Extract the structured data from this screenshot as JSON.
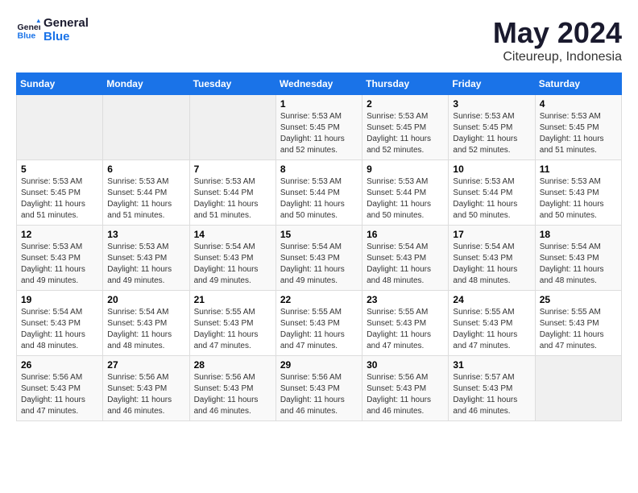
{
  "logo": {
    "line1": "General",
    "line2": "Blue"
  },
  "title": "May 2024",
  "subtitle": "Citeureup, Indonesia",
  "days_of_week": [
    "Sunday",
    "Monday",
    "Tuesday",
    "Wednesday",
    "Thursday",
    "Friday",
    "Saturday"
  ],
  "weeks": [
    [
      {
        "day": "",
        "info": ""
      },
      {
        "day": "",
        "info": ""
      },
      {
        "day": "",
        "info": ""
      },
      {
        "day": "1",
        "info": "Sunrise: 5:53 AM\nSunset: 5:45 PM\nDaylight: 11 hours and 52 minutes."
      },
      {
        "day": "2",
        "info": "Sunrise: 5:53 AM\nSunset: 5:45 PM\nDaylight: 11 hours and 52 minutes."
      },
      {
        "day": "3",
        "info": "Sunrise: 5:53 AM\nSunset: 5:45 PM\nDaylight: 11 hours and 52 minutes."
      },
      {
        "day": "4",
        "info": "Sunrise: 5:53 AM\nSunset: 5:45 PM\nDaylight: 11 hours and 51 minutes."
      }
    ],
    [
      {
        "day": "5",
        "info": "Sunrise: 5:53 AM\nSunset: 5:45 PM\nDaylight: 11 hours and 51 minutes."
      },
      {
        "day": "6",
        "info": "Sunrise: 5:53 AM\nSunset: 5:44 PM\nDaylight: 11 hours and 51 minutes."
      },
      {
        "day": "7",
        "info": "Sunrise: 5:53 AM\nSunset: 5:44 PM\nDaylight: 11 hours and 51 minutes."
      },
      {
        "day": "8",
        "info": "Sunrise: 5:53 AM\nSunset: 5:44 PM\nDaylight: 11 hours and 50 minutes."
      },
      {
        "day": "9",
        "info": "Sunrise: 5:53 AM\nSunset: 5:44 PM\nDaylight: 11 hours and 50 minutes."
      },
      {
        "day": "10",
        "info": "Sunrise: 5:53 AM\nSunset: 5:44 PM\nDaylight: 11 hours and 50 minutes."
      },
      {
        "day": "11",
        "info": "Sunrise: 5:53 AM\nSunset: 5:43 PM\nDaylight: 11 hours and 50 minutes."
      }
    ],
    [
      {
        "day": "12",
        "info": "Sunrise: 5:53 AM\nSunset: 5:43 PM\nDaylight: 11 hours and 49 minutes."
      },
      {
        "day": "13",
        "info": "Sunrise: 5:53 AM\nSunset: 5:43 PM\nDaylight: 11 hours and 49 minutes."
      },
      {
        "day": "14",
        "info": "Sunrise: 5:54 AM\nSunset: 5:43 PM\nDaylight: 11 hours and 49 minutes."
      },
      {
        "day": "15",
        "info": "Sunrise: 5:54 AM\nSunset: 5:43 PM\nDaylight: 11 hours and 49 minutes."
      },
      {
        "day": "16",
        "info": "Sunrise: 5:54 AM\nSunset: 5:43 PM\nDaylight: 11 hours and 48 minutes."
      },
      {
        "day": "17",
        "info": "Sunrise: 5:54 AM\nSunset: 5:43 PM\nDaylight: 11 hours and 48 minutes."
      },
      {
        "day": "18",
        "info": "Sunrise: 5:54 AM\nSunset: 5:43 PM\nDaylight: 11 hours and 48 minutes."
      }
    ],
    [
      {
        "day": "19",
        "info": "Sunrise: 5:54 AM\nSunset: 5:43 PM\nDaylight: 11 hours and 48 minutes."
      },
      {
        "day": "20",
        "info": "Sunrise: 5:54 AM\nSunset: 5:43 PM\nDaylight: 11 hours and 48 minutes."
      },
      {
        "day": "21",
        "info": "Sunrise: 5:55 AM\nSunset: 5:43 PM\nDaylight: 11 hours and 47 minutes."
      },
      {
        "day": "22",
        "info": "Sunrise: 5:55 AM\nSunset: 5:43 PM\nDaylight: 11 hours and 47 minutes."
      },
      {
        "day": "23",
        "info": "Sunrise: 5:55 AM\nSunset: 5:43 PM\nDaylight: 11 hours and 47 minutes."
      },
      {
        "day": "24",
        "info": "Sunrise: 5:55 AM\nSunset: 5:43 PM\nDaylight: 11 hours and 47 minutes."
      },
      {
        "day": "25",
        "info": "Sunrise: 5:55 AM\nSunset: 5:43 PM\nDaylight: 11 hours and 47 minutes."
      }
    ],
    [
      {
        "day": "26",
        "info": "Sunrise: 5:56 AM\nSunset: 5:43 PM\nDaylight: 11 hours and 47 minutes."
      },
      {
        "day": "27",
        "info": "Sunrise: 5:56 AM\nSunset: 5:43 PM\nDaylight: 11 hours and 46 minutes."
      },
      {
        "day": "28",
        "info": "Sunrise: 5:56 AM\nSunset: 5:43 PM\nDaylight: 11 hours and 46 minutes."
      },
      {
        "day": "29",
        "info": "Sunrise: 5:56 AM\nSunset: 5:43 PM\nDaylight: 11 hours and 46 minutes."
      },
      {
        "day": "30",
        "info": "Sunrise: 5:56 AM\nSunset: 5:43 PM\nDaylight: 11 hours and 46 minutes."
      },
      {
        "day": "31",
        "info": "Sunrise: 5:57 AM\nSunset: 5:43 PM\nDaylight: 11 hours and 46 minutes."
      },
      {
        "day": "",
        "info": ""
      }
    ]
  ]
}
